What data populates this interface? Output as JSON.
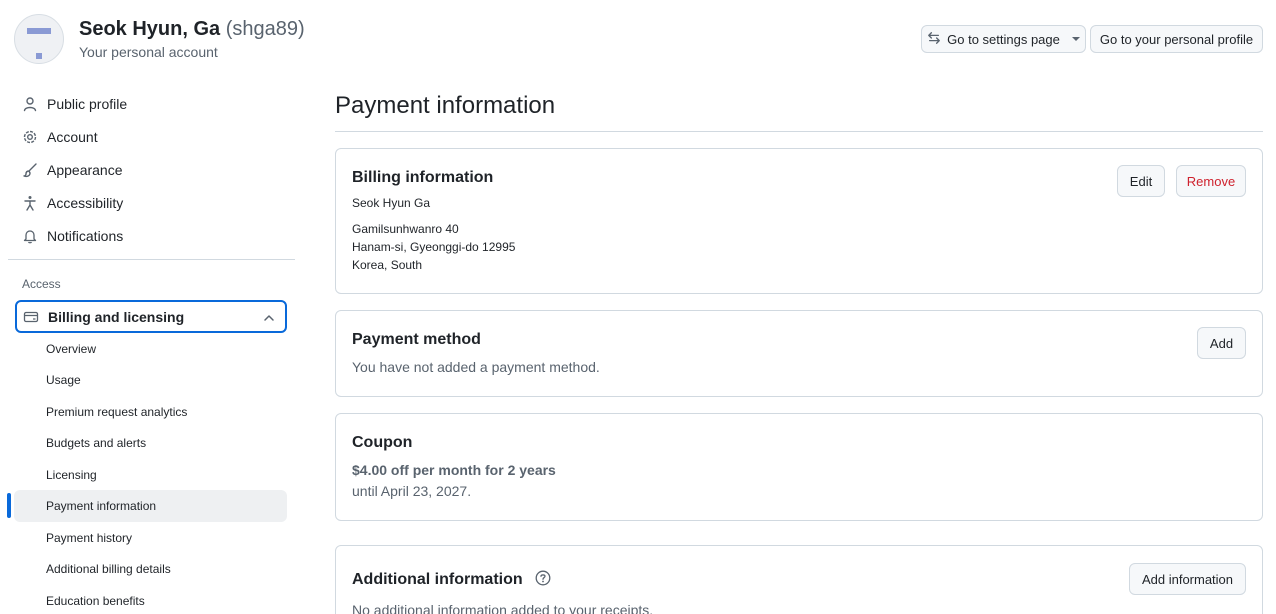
{
  "account": {
    "name": "Seok Hyun, Ga",
    "login": "(shga89)",
    "subtitle": "Your personal account"
  },
  "header_buttons": {
    "settings": "Go to settings page",
    "profile": "Go to your personal profile"
  },
  "sidebar": {
    "items": [
      {
        "label": "Public profile",
        "icon": "person-icon"
      },
      {
        "label": "Account",
        "icon": "gear-icon"
      },
      {
        "label": "Appearance",
        "icon": "paintbrush-icon"
      },
      {
        "label": "Accessibility",
        "icon": "accessibility-icon"
      },
      {
        "label": "Notifications",
        "icon": "bell-icon"
      }
    ],
    "access_heading": "Access",
    "billing_group": "Billing and licensing",
    "billing_items": [
      "Overview",
      "Usage",
      "Premium request analytics",
      "Budgets and alerts",
      "Licensing",
      "Payment information",
      "Payment history",
      "Additional billing details",
      "Education benefits"
    ],
    "active_item": "Payment information"
  },
  "main": {
    "title": "Payment information",
    "billing": {
      "heading": "Billing information",
      "name": "Seok Hyun Ga",
      "address_line1": "Gamilsunhwanro 40",
      "address_line2": "Hanam-si, Gyeonggi-do 12995",
      "address_line3": "Korea, South",
      "edit_label": "Edit",
      "remove_label": "Remove"
    },
    "payment_method": {
      "heading": "Payment method",
      "text": "You have not added a payment method.",
      "add_label": "Add"
    },
    "coupon": {
      "heading": "Coupon",
      "offer": "$4.00 off per month for 2 years",
      "until": "until April 23, 2027."
    },
    "additional": {
      "heading": "Additional information",
      "text": "No additional information added to your receipts.",
      "add_label": "Add information"
    }
  },
  "colors": {
    "accent": "#0969da",
    "danger": "#cf222e",
    "border": "#d1d9e0"
  }
}
